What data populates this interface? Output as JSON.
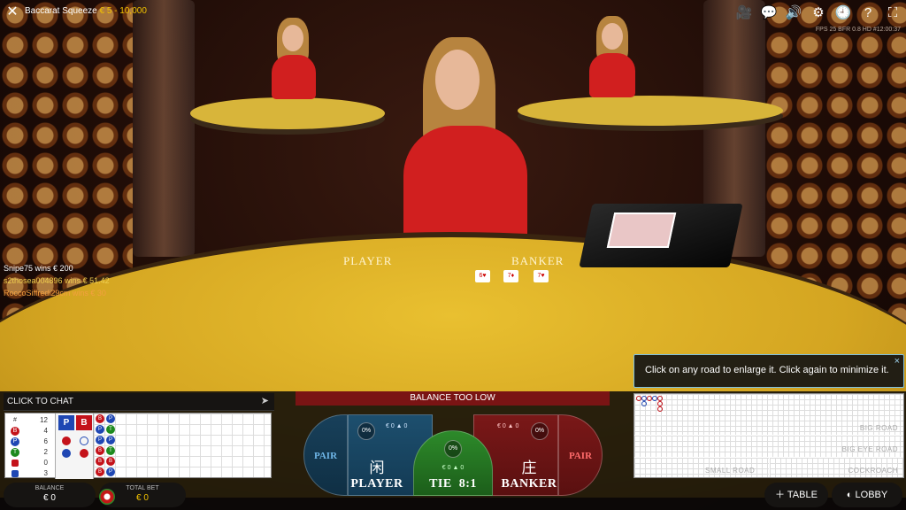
{
  "top_bar": {
    "title": "Baccarat Squeeze",
    "limits": "€ 5 - 10,000",
    "icons": [
      "video-camera-icon",
      "chat-bubbles-icon",
      "volume-icon",
      "settings-gear-icon",
      "history-clock-icon",
      "help-icon",
      "fullscreen-icon"
    ],
    "stream_info": "FPS 25 BFR 0.8 HD #12:00:37"
  },
  "table": {
    "player_label": "PLAYER",
    "banker_label": "BANKER",
    "cards": [
      "6♥",
      "7♦",
      "7♥"
    ]
  },
  "winners": [
    {
      "name": "Snipe75",
      "text": "wins € 200"
    },
    {
      "name": "s2thosea004896",
      "text": "wins € 51.42"
    },
    {
      "name": "RoccoSiffredi29cm",
      "text": "wins € 30"
    }
  ],
  "tooltip": {
    "text": "Click on any road to enlarge it. Click again to minimize it.",
    "close": "×"
  },
  "chat": {
    "label": "CLICK TO CHAT",
    "send_icon": "send-icon"
  },
  "stats": {
    "rows": [
      {
        "symbol": "#",
        "count": "12",
        "color": "#777777"
      },
      {
        "symbol": "B",
        "count": "4",
        "color": "#c4121a"
      },
      {
        "symbol": "P",
        "count": "6",
        "color": "#1f47b3"
      },
      {
        "symbol": "T",
        "count": "2",
        "color": "#1e8a1e"
      },
      {
        "symbol": "",
        "count": "0",
        "color": "#c4121a"
      },
      {
        "symbol": "",
        "count": "3",
        "color": "#1f47b3"
      }
    ],
    "predict_player": "P",
    "predict_banker": "B"
  },
  "bead_road": [
    [
      "B",
      "P",
      "P",
      "B",
      "B",
      "B"
    ],
    [
      "P",
      "T",
      "P",
      "T",
      "B",
      "P"
    ]
  ],
  "balance": {
    "label": "BALANCE",
    "value": "€ 0"
  },
  "total_bet": {
    "label": "TOTAL BET",
    "value": "€ 0"
  },
  "betting": {
    "notice": "BALANCE TOO LOW",
    "player_pair": {
      "label": "PAIR"
    },
    "player": {
      "label": "PLAYER",
      "cn": "闲",
      "pct": "0%",
      "pot": "€ 0 ▲ 0"
    },
    "tie": {
      "label": "TIE  8:1",
      "pct": "0%",
      "pot": "€ 0 ▲ 0"
    },
    "banker": {
      "label": "BANKER",
      "cn": "庄",
      "pct": "0%",
      "pot": "€ 0 ▲ 0"
    },
    "banker_pair": {
      "label": "PAIR"
    }
  },
  "roads": {
    "big_road": "BIG ROAD",
    "big_eye_road": "BIG EYE ROAD",
    "small_road": "SMALL ROAD",
    "cockroach": "COCKROACH"
  },
  "buttons": {
    "table": "TABLE",
    "lobby": "LOBBY"
  }
}
